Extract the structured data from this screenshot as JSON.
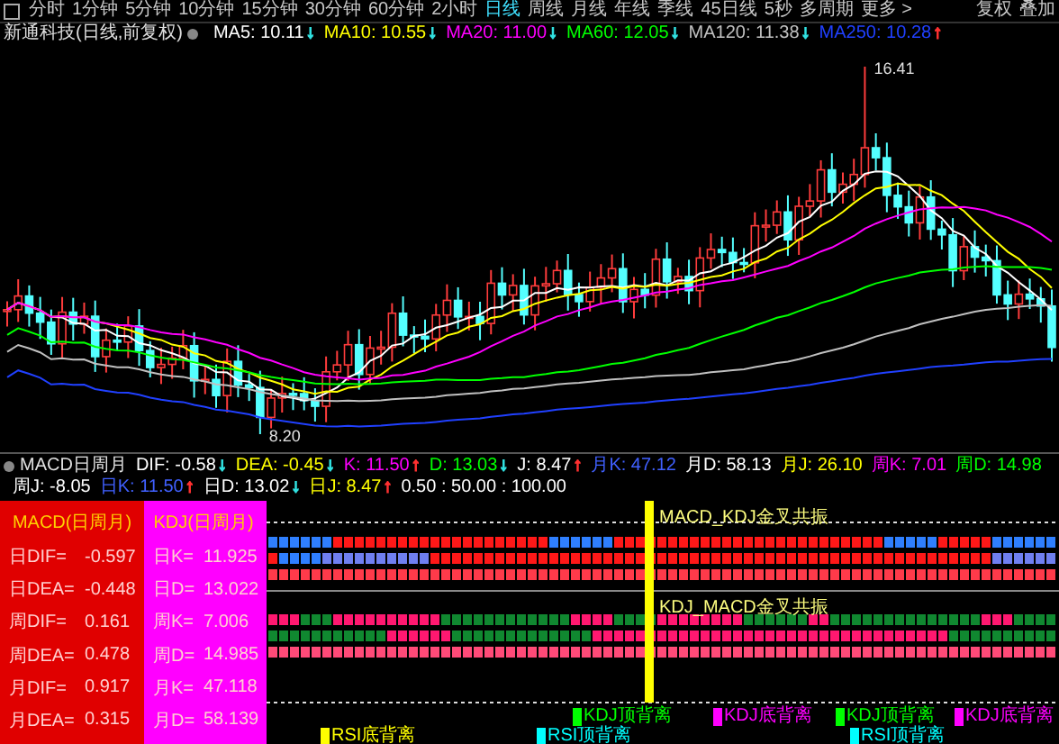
{
  "toolbar": {
    "tabs": [
      {
        "label": "分时",
        "selected": false
      },
      {
        "label": "1分钟",
        "selected": false
      },
      {
        "label": "5分钟",
        "selected": false
      },
      {
        "label": "10分钟",
        "selected": false
      },
      {
        "label": "15分钟",
        "selected": false
      },
      {
        "label": "30分钟",
        "selected": false
      },
      {
        "label": "60分钟",
        "selected": false
      },
      {
        "label": "2小时",
        "selected": false
      },
      {
        "label": "日线",
        "selected": true
      },
      {
        "label": "周线",
        "selected": false
      },
      {
        "label": "月线",
        "selected": false
      },
      {
        "label": "年线",
        "selected": false
      },
      {
        "label": "季线",
        "selected": false
      },
      {
        "label": "45日线",
        "selected": false
      },
      {
        "label": "5秒",
        "selected": false
      },
      {
        "label": "多周期",
        "selected": false
      },
      {
        "label": "更多 >",
        "selected": false
      }
    ],
    "actions": [
      "复权",
      "叠加"
    ]
  },
  "ma_bar": {
    "title": "新通科技(日线,前复权)",
    "items": [
      {
        "label": "MA5: 10.11",
        "arrow": {
          "text": "↓",
          "color": "#30e0e0"
        },
        "color": "#ffffff"
      },
      {
        "label": "MA10: 10.55",
        "arrow": {
          "text": "↓",
          "color": "#30e0e0"
        },
        "color": "#ffff00"
      },
      {
        "label": "MA20: 11.00",
        "arrow": {
          "text": "↓",
          "color": "#30e0e0"
        },
        "color": "#ff00ff"
      },
      {
        "label": "MA60: 12.05",
        "arrow": {
          "text": "↓",
          "color": "#30e0e0"
        },
        "color": "#00ff00"
      },
      {
        "label": "MA120: 11.38",
        "arrow": {
          "text": "↓",
          "color": "#30e0e0"
        },
        "color": "#c0c0c0"
      },
      {
        "label": "MA250: 10.28",
        "arrow": {
          "text": "↑",
          "color": "#ff3030"
        },
        "color": "#2040ff"
      }
    ]
  },
  "chart": {
    "high_label": "16.41",
    "low_label": "8.20"
  },
  "indicator_bar": {
    "title": "MACD日周月",
    "items": [
      {
        "label": "DIF: -0.58",
        "arrow": {
          "text": "↓",
          "color": "#30e0e0"
        },
        "color": "#ffffff"
      },
      {
        "label": "DEA: -0.45",
        "arrow": {
          "text": "↓",
          "color": "#30e0e0"
        },
        "color": "#ffff00"
      },
      {
        "label": "K: 11.50",
        "arrow": {
          "text": "↑",
          "color": "#ff3030"
        },
        "color": "#ff00ff"
      },
      {
        "label": "D: 13.03",
        "arrow": {
          "text": "↓",
          "color": "#30e0e0"
        },
        "color": "#00ff00"
      },
      {
        "label": "J: 8.47",
        "arrow": {
          "text": "↑",
          "color": "#ff3030"
        },
        "color": "#ffffff"
      },
      {
        "label": "月K: 47.12",
        "color": "#4060ff"
      },
      {
        "label": "月D: 58.13",
        "color": "#ffffff"
      },
      {
        "label": "月J: 26.10",
        "color": "#ffff00"
      },
      {
        "label": "周K: 7.01",
        "color": "#ff00ff"
      },
      {
        "label": "周D: 14.98",
        "color": "#00ff00"
      },
      {
        "label": "周J: -8.05",
        "color": "#ffffff"
      },
      {
        "label": "日K: 11.50",
        "arrow": {
          "text": "↑",
          "color": "#ff3030"
        },
        "color": "#4060ff"
      },
      {
        "label": "日D: 13.02",
        "arrow": {
          "text": "↓",
          "color": "#30e0e0"
        },
        "color": "#ffffff"
      },
      {
        "label": "日J: 8.47",
        "arrow": {
          "text": "↑",
          "color": "#ff3030"
        },
        "color": "#ffff00"
      },
      {
        "label": "0.50 : 50.00 : 100.00",
        "color": "#ffffff"
      }
    ]
  },
  "macd_table": {
    "title": "MACD(日周月)",
    "rows": [
      {
        "label": "日DIF=",
        "value": "-0.597"
      },
      {
        "label": "日DEA=",
        "value": "-0.448"
      },
      {
        "label": "周DIF=",
        "value": "0.161"
      },
      {
        "label": "周DEA=",
        "value": "0.478"
      },
      {
        "label": "月DIF=",
        "value": "0.917"
      },
      {
        "label": "月DEA=",
        "value": "0.315"
      }
    ]
  },
  "kdj_table": {
    "title": "KDJ(日周月)",
    "rows": [
      {
        "label": "日K=",
        "value": "11.925"
      },
      {
        "label": "日D=",
        "value": "13.022"
      },
      {
        "label": "周K=",
        "value": "7.006"
      },
      {
        "label": "周D=",
        "value": "14.985"
      },
      {
        "label": "月K=",
        "value": "47.118"
      },
      {
        "label": "月D=",
        "value": "58.139"
      }
    ]
  },
  "signals": {
    "markers": [
      "MACD_KDJ金叉共振",
      "KDJ_MACD金叉共振"
    ],
    "labels": [
      {
        "text": "KDJ顶背离",
        "color": "#00ff00"
      },
      {
        "text": "KDJ底背离",
        "color": "#ff00ff"
      },
      {
        "text": "KDJ顶背离",
        "color": "#00ff00"
      },
      {
        "text": "KDJ底背离",
        "color": "#ff00ff"
      },
      {
        "text": "RSI底背离",
        "color": "#ffff00"
      },
      {
        "text": "RSI顶背离",
        "color": "#00ffff"
      },
      {
        "text": "RSI顶背离",
        "color": "#00ffff"
      }
    ]
  }
}
